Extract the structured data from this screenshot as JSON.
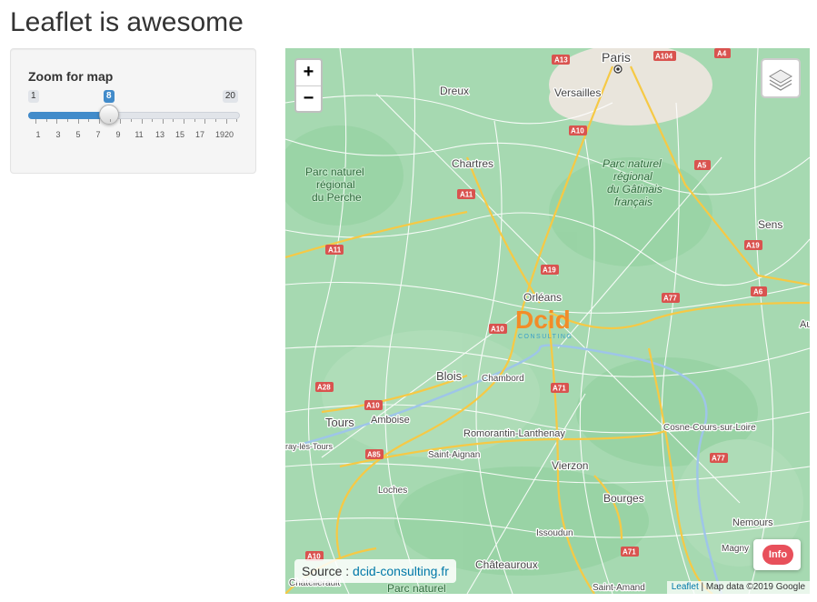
{
  "page": {
    "title": "Leaflet is awesome"
  },
  "sidebar": {
    "slider": {
      "label": "Zoom for map",
      "min": "1",
      "max": "20",
      "value": "8",
      "value_fraction": 0.368,
      "tick_labels": [
        "1",
        "3",
        "5",
        "7",
        "9",
        "11",
        "13",
        "15",
        "17",
        "1920"
      ]
    }
  },
  "map": {
    "zoom_in": "+",
    "zoom_out": "−",
    "layers_icon": "layers-icon",
    "info_button": "Info",
    "source_label": "Source : ",
    "source_link": "dcid-consulting.fr",
    "attribution_link": "Leaflet",
    "attribution_text": " | Map data ©2019 Google",
    "logo_main": "Dcid",
    "logo_sub": "CONSULTING",
    "cities": [
      {
        "name": "Paris",
        "id": "paris"
      },
      {
        "name": "Versailles",
        "id": "versailles"
      },
      {
        "name": "Dreux",
        "id": "dreux"
      },
      {
        "name": "Chartres",
        "id": "chartres"
      },
      {
        "name": "Orléans",
        "id": "orleans"
      },
      {
        "name": "Sens",
        "id": "sens"
      },
      {
        "name": "Blois",
        "id": "blois"
      },
      {
        "name": "Chambord",
        "id": "chambord"
      },
      {
        "name": "Tours",
        "id": "tours"
      },
      {
        "name": "Amboise",
        "id": "amboise"
      },
      {
        "name": "Romorantin-Lanthenay",
        "id": "romorantin"
      },
      {
        "name": "Saint-Aignan",
        "id": "saint-aignan"
      },
      {
        "name": "Vierzon",
        "id": "vierzon"
      },
      {
        "name": "Cosne-Cours-sur-Loire",
        "id": "cosne"
      },
      {
        "name": "Loches",
        "id": "loches"
      },
      {
        "name": "Bourges",
        "id": "bourges"
      },
      {
        "name": "Issoudun",
        "id": "issoudun"
      },
      {
        "name": "Nemours",
        "id": "nemours"
      },
      {
        "name": "Magny",
        "id": "magny"
      },
      {
        "name": "Châteauroux",
        "id": "chateauroux"
      },
      {
        "name": "Saint-Amand",
        "id": "saint-amand"
      },
      {
        "name": "Châtellerault",
        "id": "chatellerault"
      },
      {
        "name": "ray-lès-Tours",
        "id": "joue"
      },
      {
        "name": "Au",
        "id": "au"
      }
    ],
    "parks": [
      {
        "lines": [
          "Parc naturel",
          "régional",
          "du Perche"
        ]
      },
      {
        "lines": [
          "Parc naturel",
          "régional",
          "du Gâtinais",
          "français"
        ]
      },
      {
        "lines": [
          "Parc naturel"
        ]
      }
    ],
    "roads": [
      "A13",
      "A104",
      "A4",
      "A10",
      "A5",
      "A11",
      "A19",
      "A11",
      "A19",
      "A6",
      "A77",
      "A10",
      "A28",
      "A10",
      "A71",
      "A85",
      "A77",
      "A71",
      "A10"
    ]
  }
}
